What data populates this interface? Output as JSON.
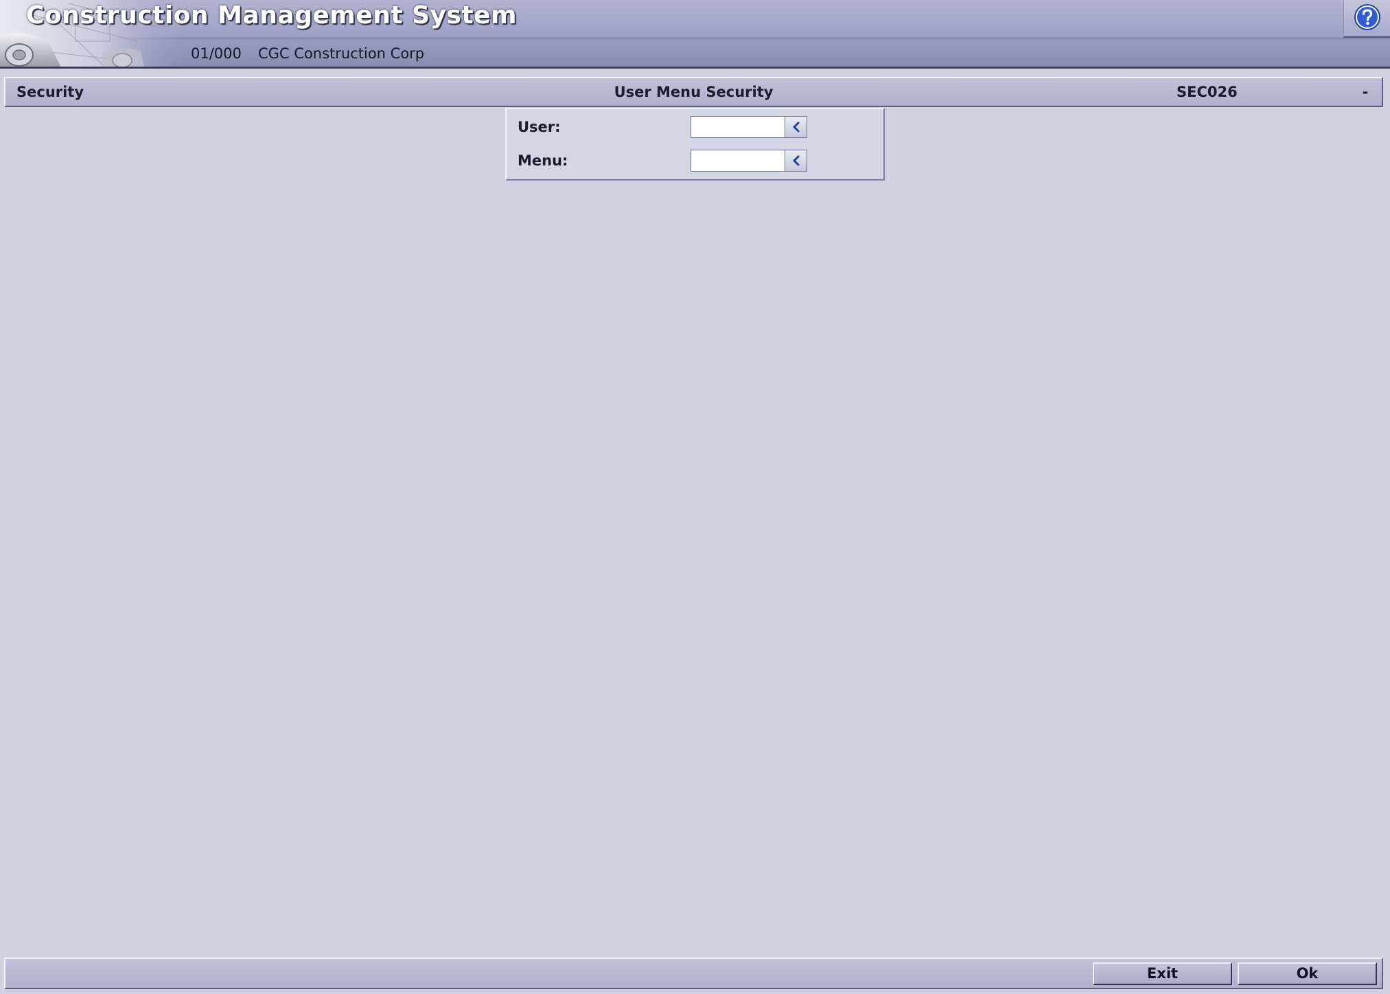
{
  "header": {
    "app_title": "Construction Management System",
    "company_code": "01/000",
    "company_name": "CGC Construction Corp",
    "help_icon": "question-mark-icon"
  },
  "screen": {
    "module": "Security",
    "title": "User Menu Security",
    "code": "SEC026",
    "minimize_label": "-"
  },
  "form": {
    "fields": [
      {
        "label": "User:",
        "value": "",
        "lookup_icon": "chevron-left-icon"
      },
      {
        "label": "Menu:",
        "value": "",
        "lookup_icon": "chevron-left-icon"
      }
    ]
  },
  "footer": {
    "exit_label": "Exit",
    "ok_label": "Ok"
  },
  "colors": {
    "background": "#cfd3e0",
    "header_band": "#9ea3c4",
    "bar": "#adb1cc",
    "help_blue": "#2f5bd6"
  }
}
